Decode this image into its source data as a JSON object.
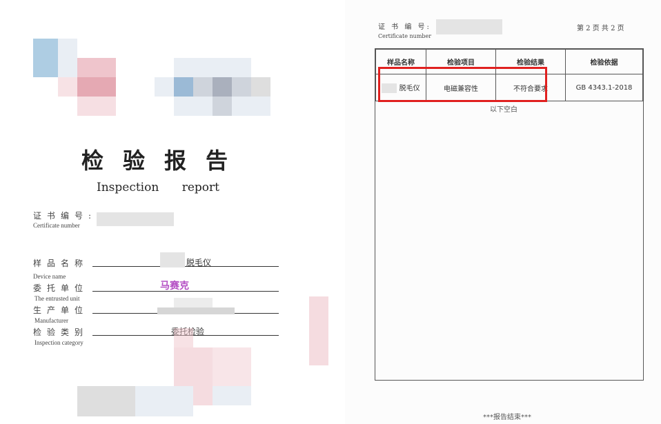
{
  "cover": {
    "title_cn": "检验报告",
    "title_en": "Inspection report",
    "cert_label_cn": "证书编号:",
    "cert_label_en": "Certificate number",
    "fields": [
      {
        "label_cn": "样品名称",
        "label_en": "Device name",
        "value": "脱毛仪"
      },
      {
        "label_cn": "委托单位",
        "label_en": "The entrusted unit",
        "value": "马赛克"
      },
      {
        "label_cn": "生产单位",
        "label_en": "Manufacturer",
        "value": ""
      },
      {
        "label_cn": "检验类别",
        "label_en": "Inspection category",
        "value": "委托检验"
      }
    ]
  },
  "result_page": {
    "cert_label_cn": "证 书 编 号:",
    "cert_label_en": "Certificate number",
    "page_info": "第 2 页 共 2 页",
    "table": {
      "headers": [
        "样品名称",
        "检验项目",
        "检验结果",
        "检验依据"
      ],
      "rows": [
        [
          "脱毛仪",
          "电磁兼容性",
          "不符合要求",
          "GB 4343.1-2018"
        ]
      ]
    },
    "empty_note": "以下空白",
    "end_note": "***报告结束***"
  }
}
